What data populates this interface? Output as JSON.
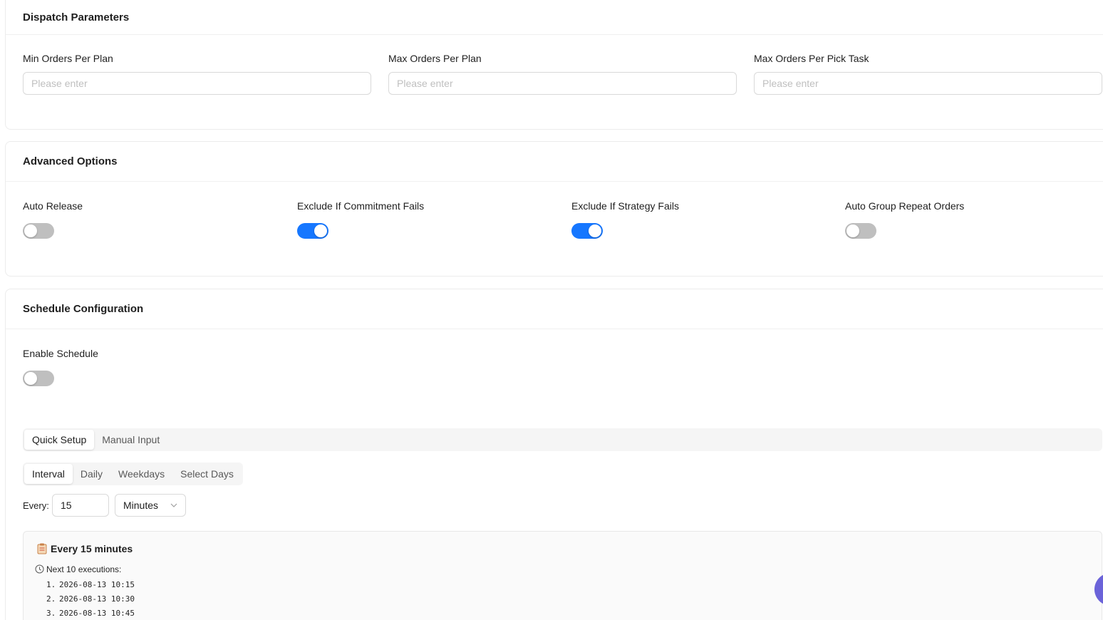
{
  "dispatch": {
    "title": "Dispatch Parameters",
    "fields": [
      {
        "label": "Min Orders Per Plan",
        "placeholder": "Please enter",
        "value": ""
      },
      {
        "label": "Max Orders Per Plan",
        "placeholder": "Please enter",
        "value": ""
      },
      {
        "label": "Max Orders Per Pick Task",
        "placeholder": "Please enter",
        "value": ""
      }
    ]
  },
  "advanced": {
    "title": "Advanced Options",
    "toggles": [
      {
        "label": "Auto Release",
        "on": false
      },
      {
        "label": "Exclude If Commitment Fails",
        "on": true
      },
      {
        "label": "Exclude If Strategy Fails",
        "on": true
      },
      {
        "label": "Auto Group Repeat Orders",
        "on": false
      }
    ]
  },
  "schedule": {
    "title": "Schedule Configuration",
    "enable_label": "Enable Schedule",
    "enable_on": false,
    "mode_tabs": [
      "Quick Setup",
      "Manual Input"
    ],
    "mode_active": "Quick Setup",
    "freq_tabs": [
      "Interval",
      "Daily",
      "Weekdays",
      "Select Days"
    ],
    "freq_active": "Interval",
    "every_label": "Every:",
    "every_value": "15",
    "unit_value": "Minutes",
    "summary": {
      "icon": "clipboard-icon",
      "title": "Every 15 minutes",
      "next_label": "Next 10 executions:",
      "executions": [
        {
          "num": "1.",
          "time": "2026-08-13 10:15"
        },
        {
          "num": "2.",
          "time": "2026-08-13 10:30"
        },
        {
          "num": "3.",
          "time": "2026-08-13 10:45"
        }
      ]
    }
  },
  "colors": {
    "primary": "#1677ff",
    "switch_off": "#bfbfbf",
    "fab": "#6b63d9"
  }
}
